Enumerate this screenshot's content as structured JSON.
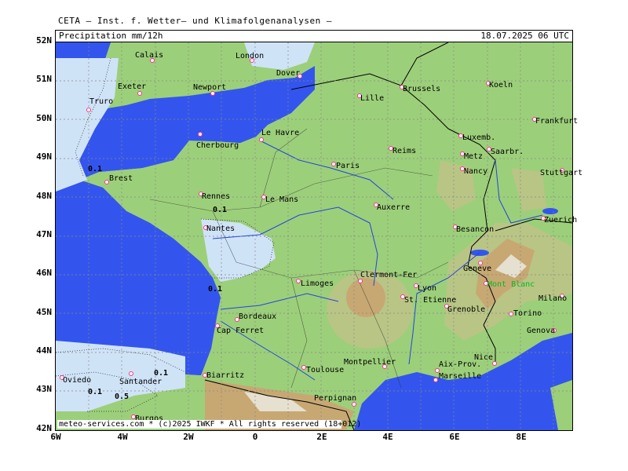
{
  "header": {
    "institute": "CETA — Inst. f. Wetter— und Klimafolgenanalysen —",
    "product": "Precipitation",
    "unit": "mm/12h",
    "datetime": "18.07.2025 06 UTC"
  },
  "axes": {
    "lat_labels": [
      "52N",
      "51N",
      "50N",
      "49N",
      "48N",
      "47N",
      "46N",
      "45N",
      "44N",
      "43N",
      "42N"
    ],
    "lon_labels": [
      "6W",
      "4W",
      "2W",
      "0",
      "2E",
      "4E",
      "6E",
      "8E"
    ]
  },
  "credit": "meteo-services.com * (c)2025 IWKF * All rights reserved (18+012)",
  "colors": {
    "sea": "#3355ee",
    "land_low": "#9ccf7a",
    "land_mid": "#b8c585",
    "land_high": "#c7a873",
    "land_peak": "#e6e0d0",
    "precip_light": "#cfe3f7",
    "precip_mid": "#a9cdf2",
    "borders": "#000000",
    "rivers": "#2244dd",
    "city_marker": "#ff3388"
  },
  "cities": [
    {
      "name": "Calais"
    },
    {
      "name": "London"
    },
    {
      "name": "Dover"
    },
    {
      "name": "Exeter"
    },
    {
      "name": "Newport"
    },
    {
      "name": "Truro"
    },
    {
      "name": "Lille"
    },
    {
      "name": "Brussels"
    },
    {
      "name": "Koeln"
    },
    {
      "name": "Frankfurt"
    },
    {
      "name": "Le Havre"
    },
    {
      "name": "Cherbourg"
    },
    {
      "name": "Reims"
    },
    {
      "name": "Luxemb."
    },
    {
      "name": "Metz"
    },
    {
      "name": "Saarbr."
    },
    {
      "name": "Paris"
    },
    {
      "name": "Nancy"
    },
    {
      "name": "Stuttgart"
    },
    {
      "name": "Brest"
    },
    {
      "name": "Rennes"
    },
    {
      "name": "Le Mans"
    },
    {
      "name": "Auxerre"
    },
    {
      "name": "Nantes"
    },
    {
      "name": "Zuerich"
    },
    {
      "name": "Besancon"
    },
    {
      "name": "Geneve"
    },
    {
      "name": "Clermont-Fer"
    },
    {
      "name": "Limoges"
    },
    {
      "name": "Lyon"
    },
    {
      "name": "Mont Blanc"
    },
    {
      "name": "St. Etienne"
    },
    {
      "name": "Milano"
    },
    {
      "name": "Grenoble"
    },
    {
      "name": "Bordeaux"
    },
    {
      "name": "Torino"
    },
    {
      "name": "Cap Ferret"
    },
    {
      "name": "Genova"
    },
    {
      "name": "Nice"
    },
    {
      "name": "Montpellier"
    },
    {
      "name": "Toulouse"
    },
    {
      "name": "Aix-Prov."
    },
    {
      "name": "Marseille"
    },
    {
      "name": "Biarritz"
    },
    {
      "name": "Perpignan"
    },
    {
      "name": "Oviedo"
    },
    {
      "name": "Santander"
    },
    {
      "name": "Burgos"
    }
  ],
  "contour_labels": [
    "0.1",
    "0.1",
    "0.1",
    "0.1",
    "0.1",
    "0.5"
  ]
}
